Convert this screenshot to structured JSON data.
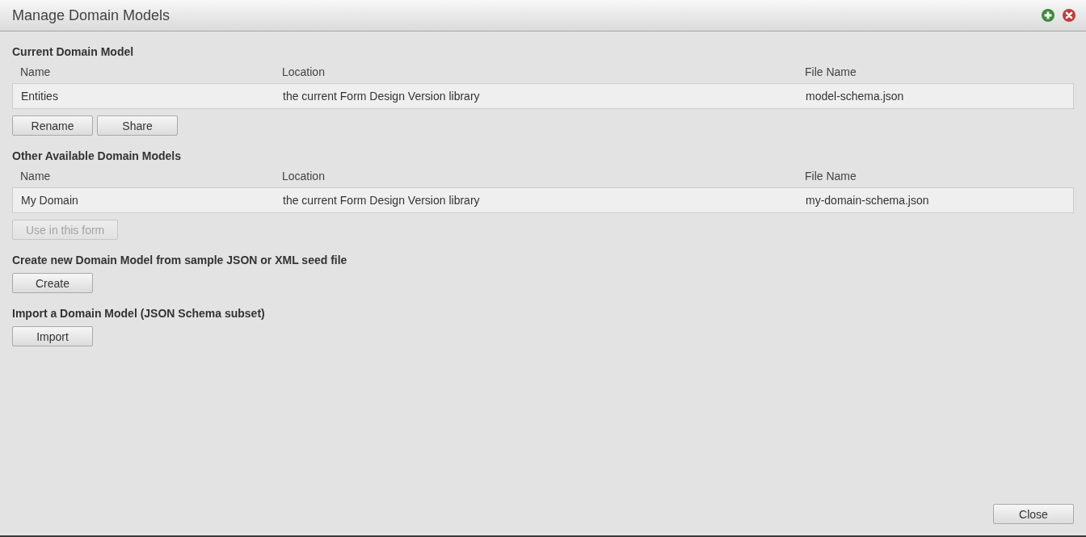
{
  "window": {
    "title": "Manage Domain Models"
  },
  "sections": [
    {
      "kind": "table",
      "heading": "Current Domain Model",
      "columns": [
        "Name",
        "Location",
        "File Name"
      ],
      "rows": [
        [
          "Entities",
          "the current Form Design Version library",
          "model-schema.json"
        ]
      ],
      "buttons": [
        {
          "label": "Rename",
          "disabled": false
        },
        {
          "label": "Share",
          "disabled": false
        }
      ]
    },
    {
      "kind": "table",
      "heading": "Other Available Domain Models",
      "columns": [
        "Name",
        "Location",
        "File Name"
      ],
      "rows": [
        [
          "My Domain",
          "the current Form Design Version library",
          "my-domain-schema.json"
        ]
      ],
      "buttons": [
        {
          "label": "Use in this form",
          "disabled": true
        }
      ]
    },
    {
      "kind": "action",
      "heading": "Create new Domain Model from sample JSON or XML seed file",
      "buttons": [
        {
          "label": "Create",
          "disabled": false
        }
      ]
    },
    {
      "kind": "action",
      "heading": "Import a Domain Model (JSON Schema subset)",
      "buttons": [
        {
          "label": "Import",
          "disabled": false
        }
      ]
    }
  ],
  "footer": {
    "buttons": [
      {
        "label": "Close",
        "disabled": false
      }
    ]
  }
}
